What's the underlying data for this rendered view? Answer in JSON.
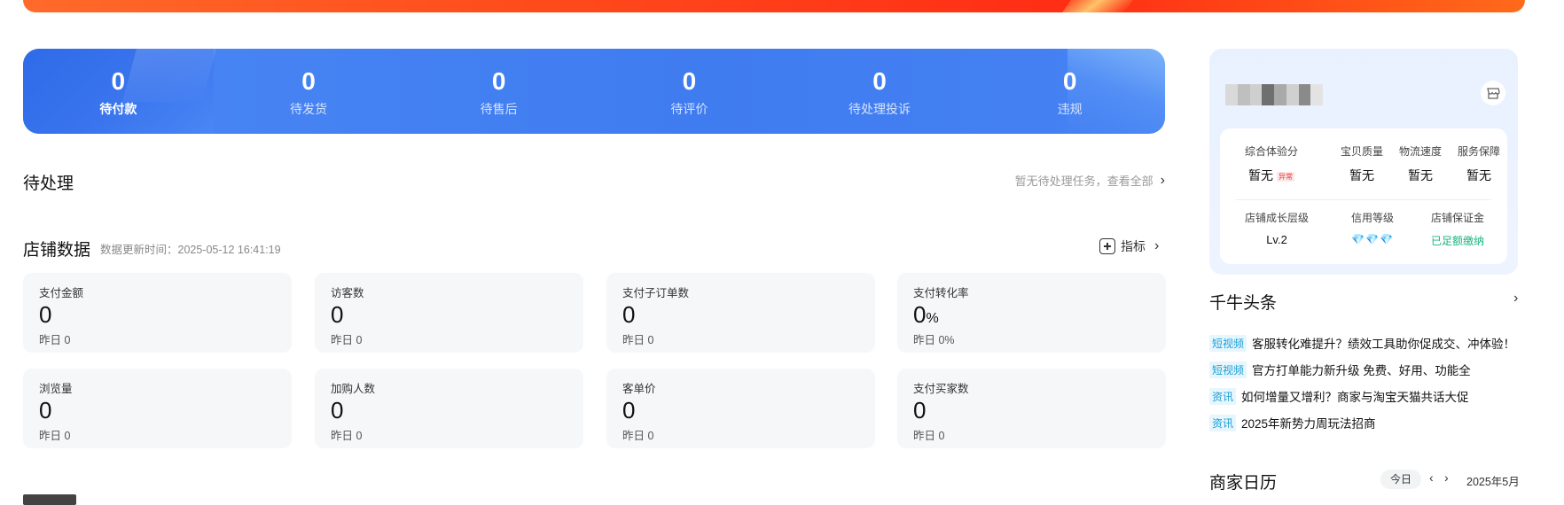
{
  "order_status": [
    {
      "count": "0",
      "label": "待付款"
    },
    {
      "count": "0",
      "label": "待发货"
    },
    {
      "count": "0",
      "label": "待售后"
    },
    {
      "count": "0",
      "label": "待评价"
    },
    {
      "count": "0",
      "label": "待处理投诉"
    },
    {
      "count": "0",
      "label": "违规"
    }
  ],
  "pending": {
    "title": "待处理",
    "link": "暂无待处理任务，查看全部"
  },
  "shop_data": {
    "title": "店铺数据",
    "update_time": "数据更新时间：2025-05-12 16:41:19",
    "metric_link": "指标",
    "cards": [
      {
        "name": "支付金额",
        "value": "0",
        "unit": "",
        "prev": "昨日 0"
      },
      {
        "name": "访客数",
        "value": "0",
        "unit": "",
        "prev": "昨日 0"
      },
      {
        "name": "支付子订单数",
        "value": "0",
        "unit": "",
        "prev": "昨日 0"
      },
      {
        "name": "支付转化率",
        "value": "0",
        "unit": "%",
        "prev": "昨日 0%"
      },
      {
        "name": "浏览量",
        "value": "0",
        "unit": "",
        "prev": "昨日 0"
      },
      {
        "name": "加购人数",
        "value": "0",
        "unit": "",
        "prev": "昨日 0"
      },
      {
        "name": "客单价",
        "value": "0",
        "unit": "",
        "prev": "昨日 0"
      },
      {
        "name": "支付买家数",
        "value": "0",
        "unit": "",
        "prev": "昨日 0"
      }
    ]
  },
  "shop_panel": {
    "scores": [
      {
        "label": "综合体验分",
        "value": "暂无",
        "tag": "异常"
      },
      {
        "label": "宝贝质量",
        "value": "暂无"
      },
      {
        "label": "物流速度",
        "value": "暂无"
      },
      {
        "label": "服务保障",
        "value": "暂无"
      }
    ],
    "growth_label": "店铺成长层级",
    "growth_value": "Lv.2",
    "credit_label": "信用等级",
    "credit_value": "💎💎💎",
    "deposit_label": "店铺保证金",
    "deposit_value": "已足额缴纳",
    "colors": {
      "deposit_ok": "#19b37b",
      "abnormal": "#e33333"
    }
  },
  "news": {
    "title": "千牛头条",
    "items": [
      {
        "tag": "短视频",
        "text": "客服转化难提升？绩效工具助你促成交、冲体验！"
      },
      {
        "tag": "短视频",
        "text": "官方打单能力新升级 免费、好用、功能全"
      },
      {
        "tag": "资讯",
        "text": "如何增量又增利？商家与淘宝天猫共话大促"
      },
      {
        "tag": "资讯",
        "text": "2025年新势力周玩法招商"
      }
    ]
  },
  "calendar": {
    "title": "商家日历",
    "today": "今日",
    "month": "2025年5月"
  },
  "colors": {
    "status_bar": "#3f7cf0",
    "banner": "#ff4a1c",
    "card_bg": "#f6f7f9"
  }
}
